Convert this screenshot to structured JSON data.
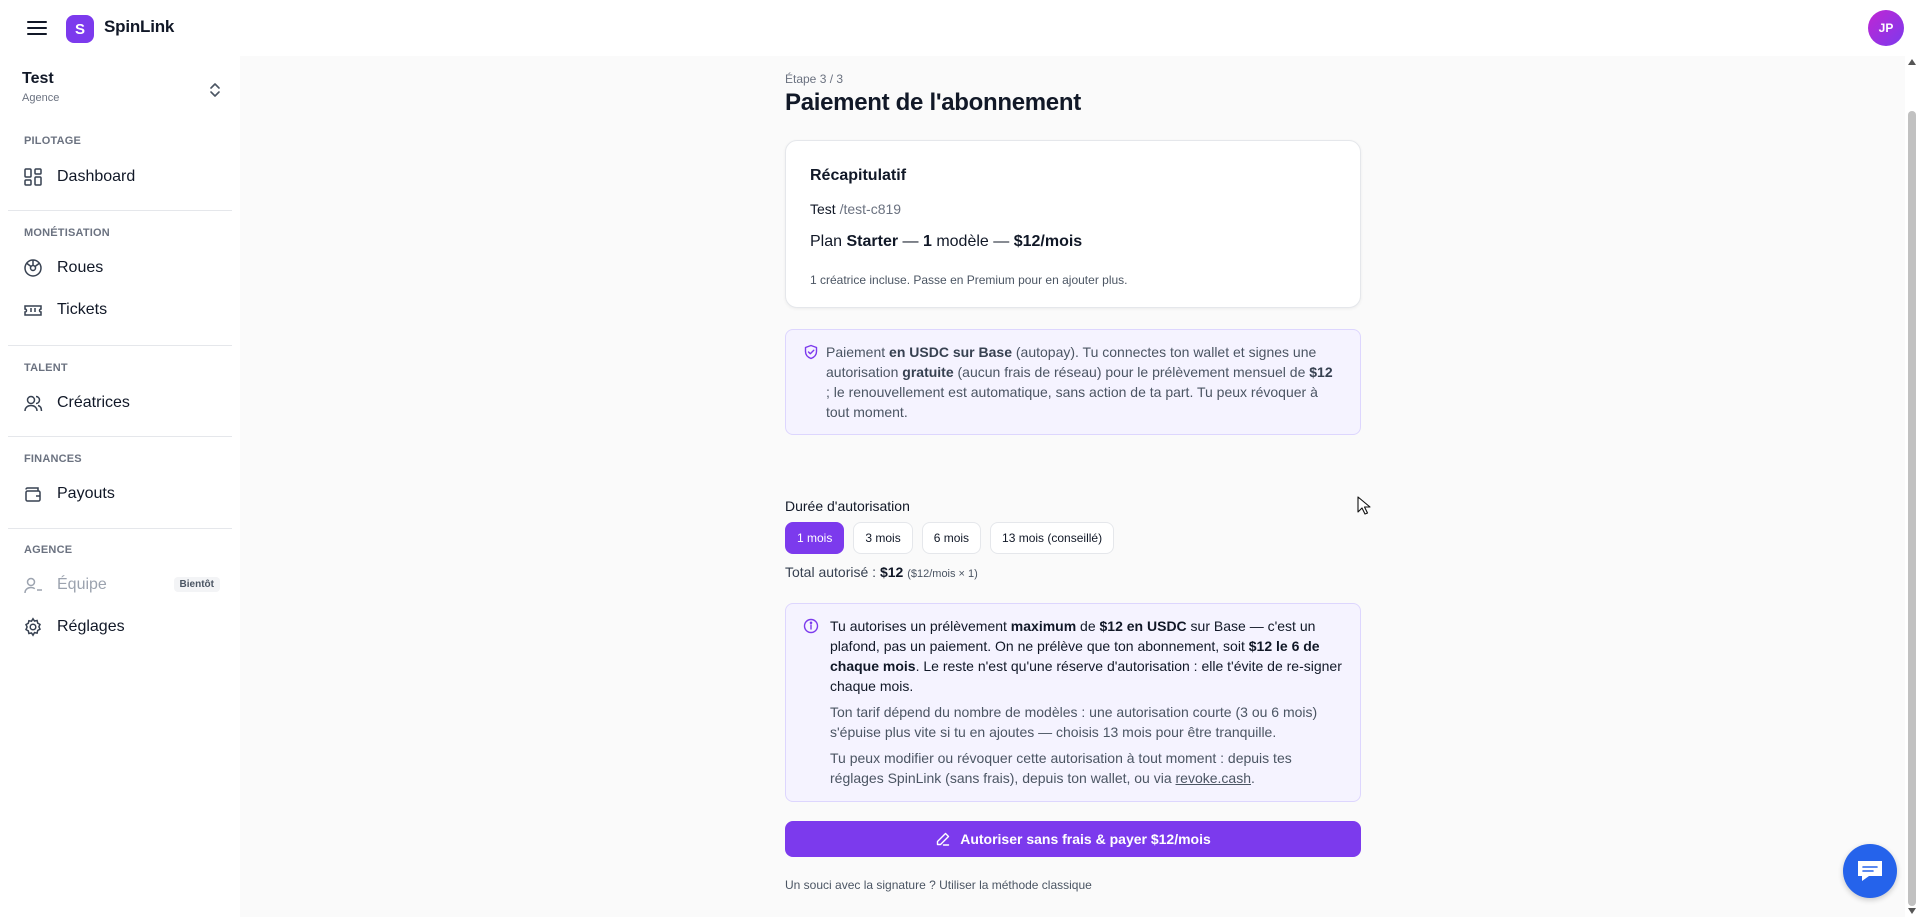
{
  "app": {
    "brand": "SpinLink",
    "logo_letter": "S",
    "user_initials": "JP",
    "accent": "#7c3aed"
  },
  "workspace": {
    "name": "Test",
    "type": "Agence"
  },
  "sidebar": {
    "sections": [
      {
        "label": "PILOTAGE",
        "items": [
          {
            "label": "Dashboard",
            "icon": "dashboard-icon"
          }
        ]
      },
      {
        "label": "MONÉTISATION",
        "items": [
          {
            "label": "Roues",
            "icon": "wheel-icon"
          },
          {
            "label": "Tickets",
            "icon": "ticket-icon"
          }
        ]
      },
      {
        "label": "TALENT",
        "items": [
          {
            "label": "Créatrices",
            "icon": "users-icon"
          }
        ]
      },
      {
        "label": "FINANCES",
        "items": [
          {
            "label": "Payouts",
            "icon": "wallet-icon"
          }
        ]
      },
      {
        "label": "AGENCE",
        "items": [
          {
            "label": "Équipe",
            "icon": "team-icon",
            "badge": "Bientôt",
            "disabled": true
          },
          {
            "label": "Réglages",
            "icon": "gear-icon"
          }
        ]
      }
    ]
  },
  "main": {
    "step": "Étape 3 / 3",
    "title": "Paiement de l'abonnement",
    "summary": {
      "title": "Récapitulatif",
      "workspace_name": "Test",
      "workspace_slug": "/test-c819",
      "plan_prefix": "Plan",
      "plan_name": "Starter",
      "plan_sep1": "—",
      "plan_models": "1",
      "plan_models_label": "modèle",
      "plan_sep2": "—",
      "plan_price": "$12/mois",
      "note": "1 créatrice incluse. Passe en Premium pour en ajouter plus."
    },
    "payment_info": {
      "t1": "Paiement ",
      "b1": "en USDC sur Base",
      "t2": " (autopay). Tu connectes ton wallet et signes une autorisation ",
      "b2": "gratuite",
      "t3": " (aucun frais de réseau) pour le prélèvement mensuel de ",
      "b3": "$12",
      "t4": " ; le renouvellement est automatique, sans action de ta part. Tu peux révoquer à tout moment."
    },
    "duration": {
      "label": "Durée d'autorisation",
      "options": [
        "1 mois",
        "3 mois",
        "6 mois",
        "13 mois (conseillé)"
      ],
      "selected": "1 mois",
      "total_label": "Total autorisé :",
      "total_value": "$12",
      "total_detail": "($12/mois × 1)"
    },
    "auth_info": {
      "p1_t1": "Tu autorises un prélèvement ",
      "p1_b1": "maximum",
      "p1_t2": " de ",
      "p1_b2": "$12 en USDC",
      "p1_t3": " sur Base — c'est un plafond, pas un paiement. On ne prélève que ton abonnement, soit ",
      "p1_b3": "$12 le 6 de chaque mois",
      "p1_t4": ". Le reste n'est qu'une réserve d'autorisation : elle t'évite de re-signer chaque mois.",
      "p2": "Ton tarif dépend du nombre de modèles : une autorisation courte (3 ou 6 mois) s'épuise plus vite si tu en ajoutes — choisis 13 mois pour être tranquille.",
      "p3_t1": "Tu peux modifier ou révoquer cette autorisation à tout moment : depuis tes réglages SpinLink (sans frais), depuis ton wallet, ou via ",
      "p3_link": "revoke.cash",
      "p3_t2": "."
    },
    "cta_label": "Autoriser sans frais & payer $12/mois",
    "fallback_text": "Un souci avec la signature ? Utiliser la méthode classique"
  }
}
